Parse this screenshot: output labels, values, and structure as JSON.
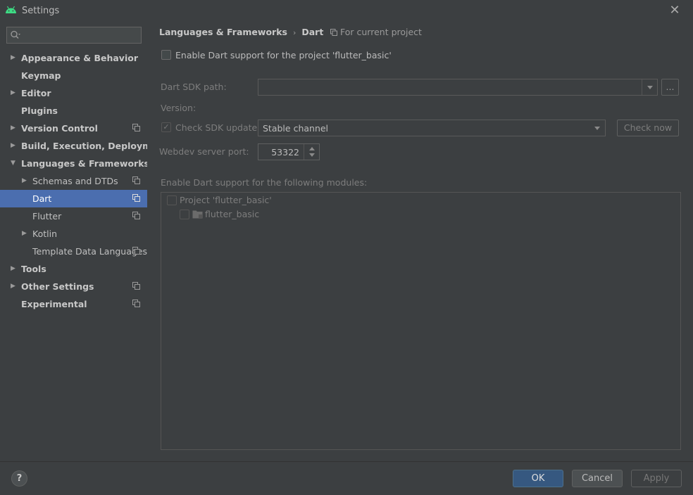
{
  "window": {
    "title": "Settings"
  },
  "sidebar": {
    "search_placeholder": "",
    "items": [
      {
        "label": "Appearance & Behavior",
        "level": 0,
        "bold": true,
        "arrow": "collapsed",
        "scope": false,
        "selected": false
      },
      {
        "label": "Keymap",
        "level": 0,
        "bold": true,
        "arrow": "none",
        "scope": false,
        "selected": false
      },
      {
        "label": "Editor",
        "level": 0,
        "bold": true,
        "arrow": "collapsed",
        "scope": false,
        "selected": false
      },
      {
        "label": "Plugins",
        "level": 0,
        "bold": true,
        "arrow": "none",
        "scope": false,
        "selected": false
      },
      {
        "label": "Version Control",
        "level": 0,
        "bold": true,
        "arrow": "collapsed",
        "scope": true,
        "selected": false
      },
      {
        "label": "Build, Execution, Deployment",
        "level": 0,
        "bold": true,
        "arrow": "collapsed",
        "scope": false,
        "selected": false
      },
      {
        "label": "Languages & Frameworks",
        "level": 0,
        "bold": true,
        "arrow": "expanded",
        "scope": false,
        "selected": false
      },
      {
        "label": "Schemas and DTDs",
        "level": 1,
        "bold": false,
        "arrow": "collapsed",
        "scope": true,
        "selected": false
      },
      {
        "label": "Dart",
        "level": 1,
        "bold": false,
        "arrow": "none",
        "scope": true,
        "selected": true
      },
      {
        "label": "Flutter",
        "level": 1,
        "bold": false,
        "arrow": "none",
        "scope": true,
        "selected": false
      },
      {
        "label": "Kotlin",
        "level": 1,
        "bold": false,
        "arrow": "collapsed",
        "scope": false,
        "selected": false
      },
      {
        "label": "Template Data Languages",
        "level": 1,
        "bold": false,
        "arrow": "none",
        "scope": true,
        "selected": false
      },
      {
        "label": "Tools",
        "level": 0,
        "bold": true,
        "arrow": "collapsed",
        "scope": false,
        "selected": false
      },
      {
        "label": "Other Settings",
        "level": 0,
        "bold": true,
        "arrow": "collapsed",
        "scope": true,
        "selected": false
      },
      {
        "label": "Experimental",
        "level": 0,
        "bold": true,
        "arrow": "none",
        "scope": true,
        "selected": false
      }
    ]
  },
  "breadcrumb": {
    "parent": "Languages & Frameworks",
    "current": "Dart",
    "scope_note": "For current project"
  },
  "dart": {
    "enable_label": "Enable Dart support for the project 'flutter_basic'",
    "enable_checked": false,
    "sdk_path_label": "Dart SDK path:",
    "sdk_path_value": "",
    "browse_label": "...",
    "version_label": "Version:",
    "check_update_label": "Check SDK update:",
    "check_update_checked": true,
    "channel_value": "Stable channel",
    "check_now_label": "Check now",
    "webdev_label": "Webdev server port:",
    "webdev_port": "53322",
    "modules_label": "Enable Dart support for the following modules:",
    "modules": [
      {
        "label": "Project 'flutter_basic'",
        "level": 0
      },
      {
        "label": "flutter_basic",
        "level": 1
      }
    ]
  },
  "footer": {
    "help_label": "?",
    "ok_label": "OK",
    "cancel_label": "Cancel",
    "apply_label": "Apply"
  },
  "colors": {
    "background": "#3c3f41",
    "selection": "#4b6eaf",
    "ok_button": "#365880",
    "android_logo": "#3ddc84"
  }
}
